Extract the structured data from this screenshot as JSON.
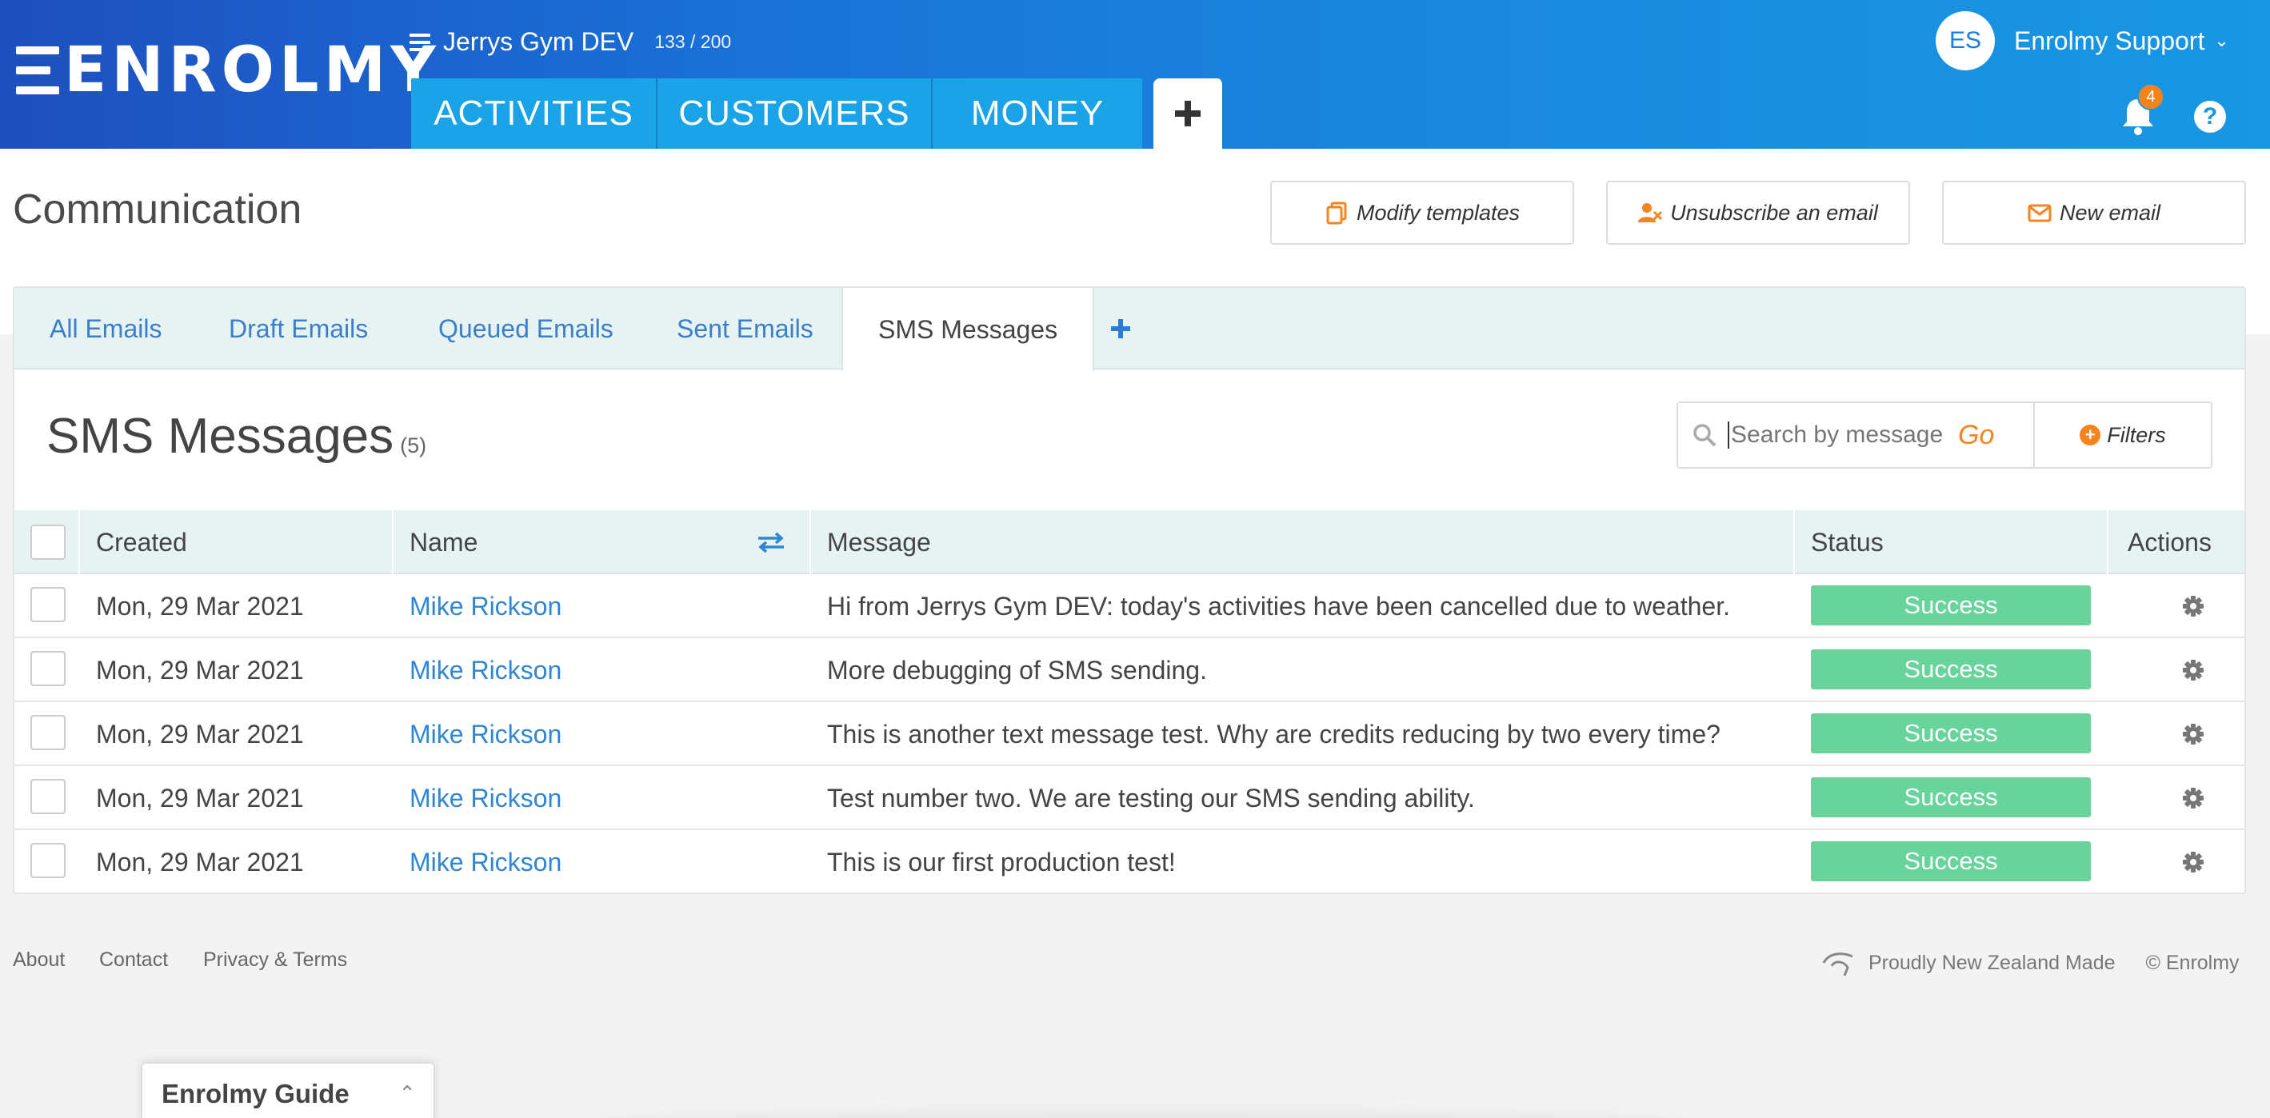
{
  "header": {
    "logo": "ENROLMY",
    "org_name": "Jerrys Gym DEV",
    "org_count": "133 / 200",
    "nav_tabs": [
      "ACTIVITIES",
      "CUSTOMERS",
      "MONEY"
    ],
    "add_tab": "+",
    "user_initials": "ES",
    "user_name": "Enrolmy Support",
    "notification_count": "4",
    "help": "?"
  },
  "page": {
    "title": "Communication",
    "actions": {
      "modify_templates": "Modify templates",
      "unsubscribe": "Unsubscribe an email",
      "new_email": "New email"
    }
  },
  "subtabs": [
    "All Emails",
    "Draft Emails",
    "Queued Emails",
    "Sent Emails",
    "SMS Messages"
  ],
  "subtabs_add": "+",
  "sms": {
    "heading": "SMS Messages",
    "count": "(5)",
    "search_placeholder": "Search by message",
    "go": "Go",
    "filters": "Filters"
  },
  "table": {
    "headers": {
      "created": "Created",
      "name": "Name",
      "message": "Message",
      "status": "Status",
      "actions": "Actions"
    },
    "rows": [
      {
        "created": "Mon, 29 Mar 2021",
        "name": "Mike Rickson",
        "message": "Hi from Jerrys Gym DEV: today's activities have been cancelled due to weather.",
        "status": "Success"
      },
      {
        "created": "Mon, 29 Mar 2021",
        "name": "Mike Rickson",
        "message": "More debugging of SMS sending.",
        "status": "Success"
      },
      {
        "created": "Mon, 29 Mar 2021",
        "name": "Mike Rickson",
        "message": "This is another text message test. Why are credits reducing by two every time?",
        "status": "Success"
      },
      {
        "created": "Mon, 29 Mar 2021",
        "name": "Mike Rickson",
        "message": "Test number two. We are testing our SMS sending ability.",
        "status": "Success"
      },
      {
        "created": "Mon, 29 Mar 2021",
        "name": "Mike Rickson",
        "message": "This is our first production test!",
        "status": "Success"
      }
    ]
  },
  "footer": {
    "about": "About",
    "contact": "Contact",
    "privacy": "Privacy & Terms",
    "nz_made": "Proudly New Zealand Made",
    "copyright": "© Enrolmy"
  },
  "guide": {
    "title": "Enrolmy Guide"
  },
  "colors": {
    "header_start": "#1f4fbf",
    "header_end": "#1897e2",
    "nav_tab": "#1aa3e6",
    "accent_orange": "#f5841f",
    "link_blue": "#2f86d3",
    "success_green": "#68d39b",
    "tab_bar": "#e7f3f3"
  },
  "icons": [
    "hamburger-icon",
    "bell-icon",
    "help-icon",
    "chevron-down-icon",
    "plus-icon",
    "copy-icon",
    "user-remove-icon",
    "envelope-icon",
    "search-icon",
    "plus-circle-icon",
    "swap-icon",
    "gear-icon",
    "nz-map-icon",
    "chevron-up-icon"
  ]
}
